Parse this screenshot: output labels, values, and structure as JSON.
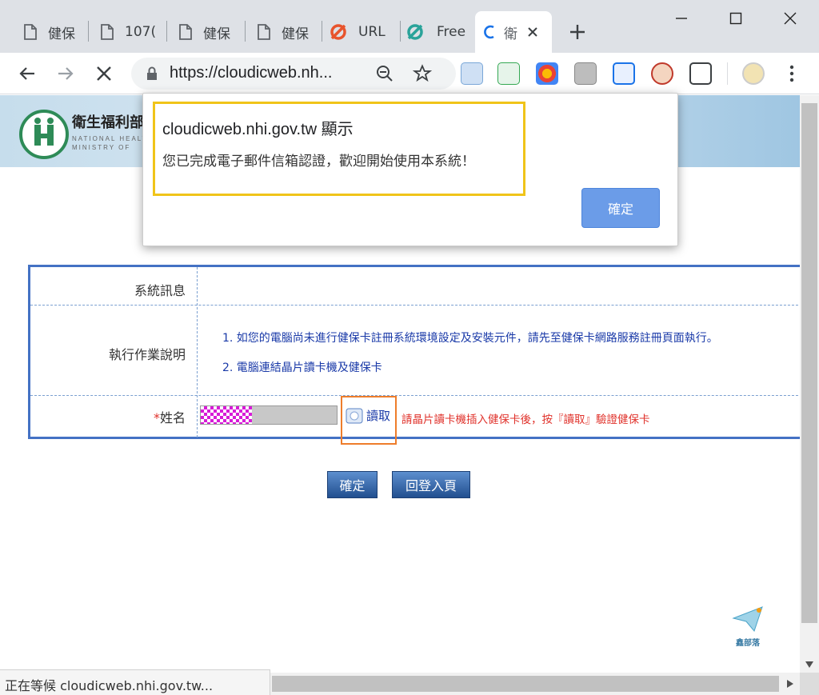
{
  "browser": {
    "tabs": [
      {
        "label": "健保",
        "icon": "doc-icon"
      },
      {
        "label": "107(",
        "icon": "doc-icon"
      },
      {
        "label": "健保",
        "icon": "doc-icon"
      },
      {
        "label": "健保",
        "icon": "doc-icon"
      },
      {
        "label": "URL",
        "icon": "url-shortener-icon"
      },
      {
        "label": "Free",
        "icon": "free-icon"
      },
      {
        "label": "衛",
        "icon": "loading-spinner-icon"
      }
    ],
    "url": "https://cloudicweb.nh...",
    "status_text": "正在等候 cloudicweb.nhi.gov.tw..."
  },
  "site": {
    "name": "衛生福利部",
    "name_en_1": "NATIONAL HEALTH",
    "name_en_2": "MINISTRY OF"
  },
  "dialog": {
    "title": "cloudicweb.nhi.gov.tw 顯示",
    "message": "您已完成電子郵件信箱認證，歡迎開始使用本系統！",
    "ok_label": "確定"
  },
  "form": {
    "system_message_label": "系統訊息",
    "instructions_label": "執行作業說明",
    "instructions": [
      "1. 如您的電腦尚未進行健保卡註冊系統環境設定及安裝元件，請先至健保卡網路服務註冊頁面執行。",
      "2. 電腦連結晶片讀卡機及健保卡"
    ],
    "name_required_mark": "*",
    "name_label": "姓名",
    "read_button": "讀取",
    "read_hint": "請晶片讀卡機插入健保卡後，按『讀取』驗證健保卡",
    "confirm_button": "確定",
    "back_button": "回登入頁"
  },
  "watermark": "鑫部落",
  "colors": {
    "accent_blue": "#4472c4",
    "dialog_button": "#6b9ce8",
    "hint_red": "#e0322b",
    "highlight_yellow": "#f0c419",
    "highlight_orange": "#ee7d2b"
  }
}
